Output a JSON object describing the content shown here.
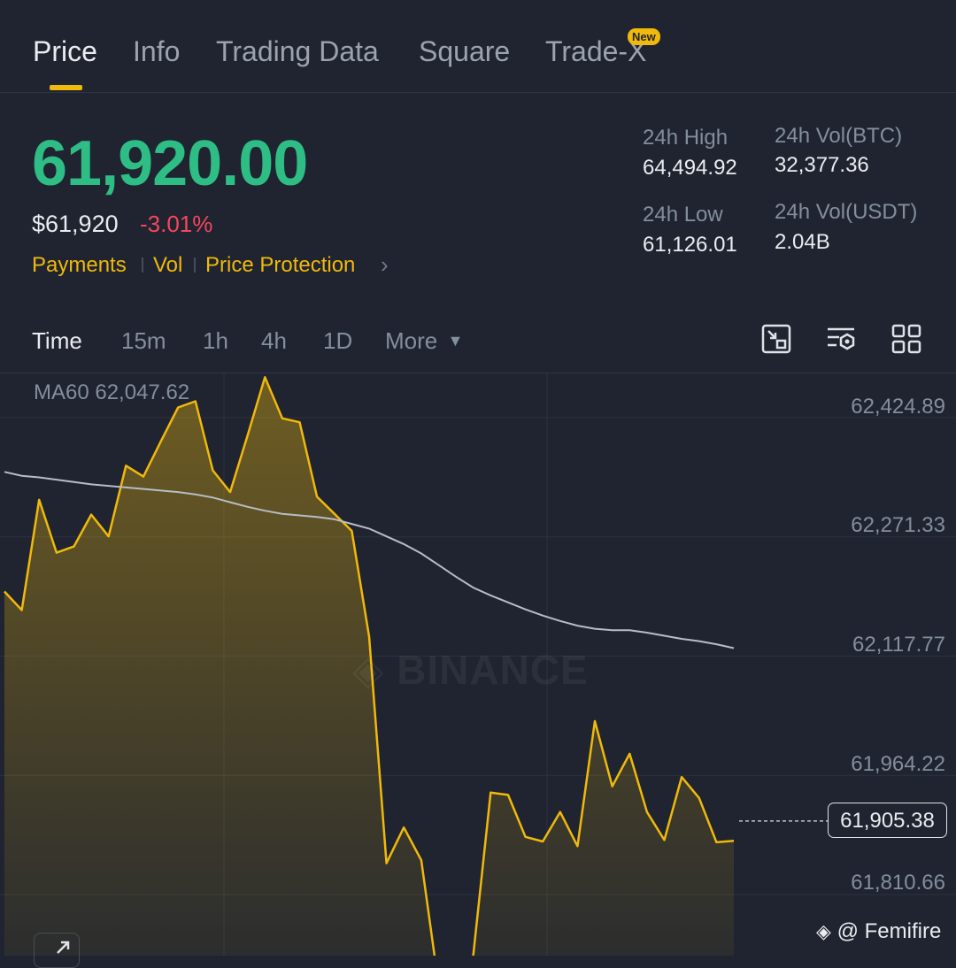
{
  "tabs": [
    {
      "label": "Price"
    },
    {
      "label": "Info"
    },
    {
      "label": "Trading Data"
    },
    {
      "label": "Square"
    },
    {
      "label": "Trade-X",
      "badge": "New"
    }
  ],
  "price": {
    "last": "61,920.00",
    "usd": "$61,920",
    "change_pct": "-3.01%",
    "links": [
      "Payments",
      "Vol",
      "Price Protection"
    ]
  },
  "stats": {
    "high_label": "24h High",
    "high_value": "64,494.92",
    "low_label": "24h Low",
    "low_value": "61,126.01",
    "vol_btc_label": "24h Vol(BTC)",
    "vol_btc_value": "32,377.36",
    "vol_usdt_label": "24h Vol(USDT)",
    "vol_usdt_value": "2.04B"
  },
  "toolbar": {
    "timeframes": [
      "Time",
      "15m",
      "1h",
      "4h",
      "1D"
    ],
    "more_label": "More",
    "icons": [
      "chart-compare-icon",
      "chart-settings-icon",
      "grid-layout-icon"
    ]
  },
  "chart": {
    "ma_label": "MA60 62,047.62",
    "current_price_tag": "61,905.38",
    "watermark": "BINANCE",
    "credit": "@ Femifire"
  },
  "colors": {
    "background": "#1f2430",
    "price_up": "#2ebd85",
    "price_down": "#f6465d",
    "accent": "#f0b90b",
    "ma_line": "#b7bdc6"
  },
  "chart_data": {
    "type": "area",
    "ylim": [
      61760,
      62480
    ],
    "yticks": [
      "62,424.89",
      "62,271.33",
      "62,117.77",
      "61,964.22",
      "61,810.66"
    ],
    "series": [
      {
        "y": [
          62201,
          62177,
          62319,
          62251,
          62259,
          62300,
          62272,
          62363,
          62349,
          62394,
          62438,
          62446,
          62357,
          62329,
          62402,
          62477,
          62424,
          62419,
          62323,
          62301,
          62279,
          62143,
          61851,
          61897,
          61855,
          61694,
          61659,
          61733,
          61942,
          61939,
          61885,
          61879,
          61917,
          61873,
          62034,
          61950,
          61992,
          61917,
          61881,
          61962,
          61935,
          61878,
          61880
        ]
      },
      {
        "y": [
          62355,
          62350,
          62348,
          62345,
          62342,
          62339,
          62337,
          62335,
          62333,
          62331,
          62329,
          62326,
          62322,
          62316,
          62310,
          62305,
          62301,
          62299,
          62297,
          62294,
          62288,
          62282,
          62272,
          62262,
          62250,
          62235,
          62220,
          62206,
          62196,
          62187,
          62178,
          62170,
          62163,
          62157,
          62153,
          62151,
          62151,
          62148,
          62144,
          62140,
          62137,
          62133,
          62128
        ]
      }
    ]
  }
}
